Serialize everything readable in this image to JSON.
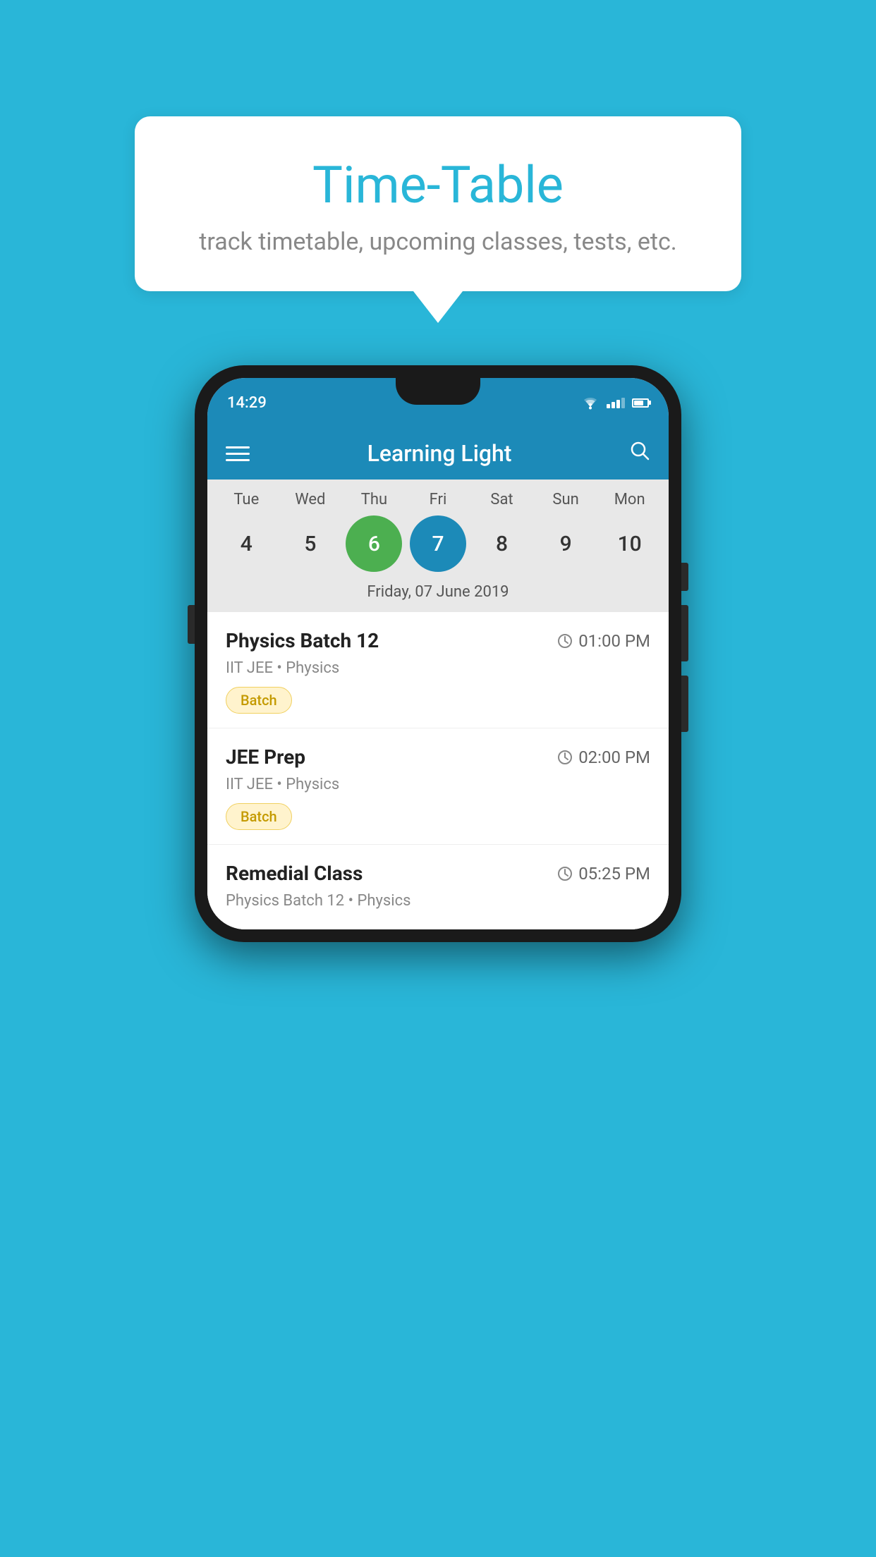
{
  "background_color": "#29B6D8",
  "speech_bubble": {
    "title": "Time-Table",
    "subtitle": "track timetable, upcoming classes, tests, etc."
  },
  "phone": {
    "status_bar": {
      "time": "14:29"
    },
    "top_bar": {
      "app_name": "Learning Light"
    },
    "calendar": {
      "days": [
        {
          "label": "Tue",
          "number": "4"
        },
        {
          "label": "Wed",
          "number": "5"
        },
        {
          "label": "Thu",
          "number": "6",
          "state": "today"
        },
        {
          "label": "Fri",
          "number": "7",
          "state": "selected"
        },
        {
          "label": "Sat",
          "number": "8"
        },
        {
          "label": "Sun",
          "number": "9"
        },
        {
          "label": "Mon",
          "number": "10"
        }
      ],
      "selected_date": "Friday, 07 June 2019"
    },
    "classes": [
      {
        "name": "Physics Batch 12",
        "time": "01:00 PM",
        "meta": "IIT JEE • Physics",
        "badge": "Batch"
      },
      {
        "name": "JEE Prep",
        "time": "02:00 PM",
        "meta": "IIT JEE • Physics",
        "badge": "Batch"
      },
      {
        "name": "Remedial Class",
        "time": "05:25 PM",
        "meta": "Physics Batch 12 • Physics",
        "badge": ""
      }
    ]
  }
}
